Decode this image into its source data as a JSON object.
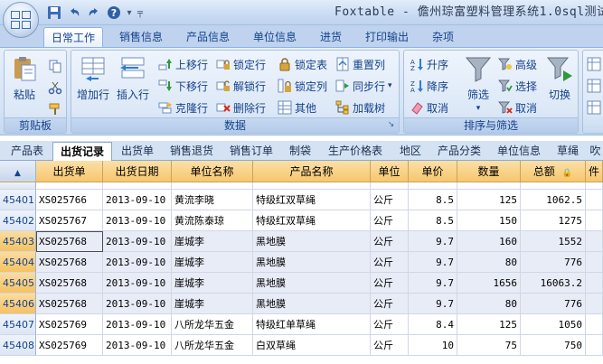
{
  "window": {
    "title": "Foxtable - 儋州琮富塑料管理系统1.0sql测试"
  },
  "ribbon_tabs": [
    "日常工作",
    "销售信息",
    "产品信息",
    "单位信息",
    "进货",
    "打印输出",
    "杂项"
  ],
  "ribbon": {
    "clipboard": {
      "label": "剪贴板",
      "paste": "粘贴"
    },
    "data": {
      "label": "数据",
      "add_row": "增加行",
      "insert_row": "插入行",
      "move_up": "上移行",
      "move_down": "下移行",
      "clone": "克隆行",
      "lock_row": "锁定行",
      "unlock": "解锁行",
      "delete_row": "删除行",
      "lock_table": "锁定表",
      "lock_col": "锁定列",
      "other": "其他",
      "reset_col": "重置列",
      "sync": "同步行",
      "load_tree": "加载树"
    },
    "sort_filter": {
      "label": "排序与筛选",
      "asc": "升序",
      "desc": "降序",
      "cancel_sort": "取消",
      "filter": "筛选",
      "advanced": "高级",
      "select": "选择",
      "cancel_filter": "取消",
      "switch": "切换"
    }
  },
  "sheet_tabs": [
    "产品表",
    "出货记录",
    "出货单",
    "销售退货",
    "销售订单",
    "制袋",
    "生产价格表",
    "地区",
    "产品分类",
    "单位信息",
    "草绳",
    "吹"
  ],
  "table": {
    "columns": [
      "出货单",
      "出货日期",
      "单位名称",
      "产品名称",
      "单位",
      "单价",
      "数量",
      "总额",
      "件"
    ],
    "rows": [
      {
        "id": "",
        "order": "",
        "date": "",
        "company": "",
        "product": "",
        "unit": "",
        "price": "",
        "qty": "",
        "total": ""
      },
      {
        "id": "45401",
        "order": "XS025766",
        "date": "2013-09-10",
        "company": "黄流李晓",
        "product": "特级红双草绳",
        "unit": "公斤",
        "price": "8.5",
        "qty": "125",
        "total": "1062.5"
      },
      {
        "id": "45402",
        "order": "XS025767",
        "date": "2013-09-10",
        "company": "黄流陈泰琼",
        "product": "特级红双草绳",
        "unit": "公斤",
        "price": "8.5",
        "qty": "150",
        "total": "1275"
      },
      {
        "id": "45403",
        "order": "XS025768",
        "date": "2013-09-10",
        "company": "崖城李",
        "product": "黑地膜",
        "unit": "公斤",
        "price": "9.7",
        "qty": "160",
        "total": "1552"
      },
      {
        "id": "45404",
        "order": "XS025768",
        "date": "2013-09-10",
        "company": "崖城李",
        "product": "黑地膜",
        "unit": "公斤",
        "price": "9.7",
        "qty": "80",
        "total": "776"
      },
      {
        "id": "45405",
        "order": "XS025768",
        "date": "2013-09-10",
        "company": "崖城李",
        "product": "黑地膜",
        "unit": "公斤",
        "price": "9.7",
        "qty": "1656",
        "total": "16063.2"
      },
      {
        "id": "45406",
        "order": "XS025768",
        "date": "2013-09-10",
        "company": "崖城李",
        "product": "黑地膜",
        "unit": "公斤",
        "price": "9.7",
        "qty": "80",
        "total": "776"
      },
      {
        "id": "45407",
        "order": "XS025769",
        "date": "2013-09-10",
        "company": "八所龙华五金",
        "product": "特级红单草绳",
        "unit": "公斤",
        "price": "8.4",
        "qty": "125",
        "total": "1050"
      },
      {
        "id": "45408",
        "order": "XS025769",
        "date": "2013-09-10",
        "company": "八所龙华五金",
        "product": "白双草绳",
        "unit": "公斤",
        "price": "10",
        "qty": "75",
        "total": "750"
      }
    ]
  }
}
